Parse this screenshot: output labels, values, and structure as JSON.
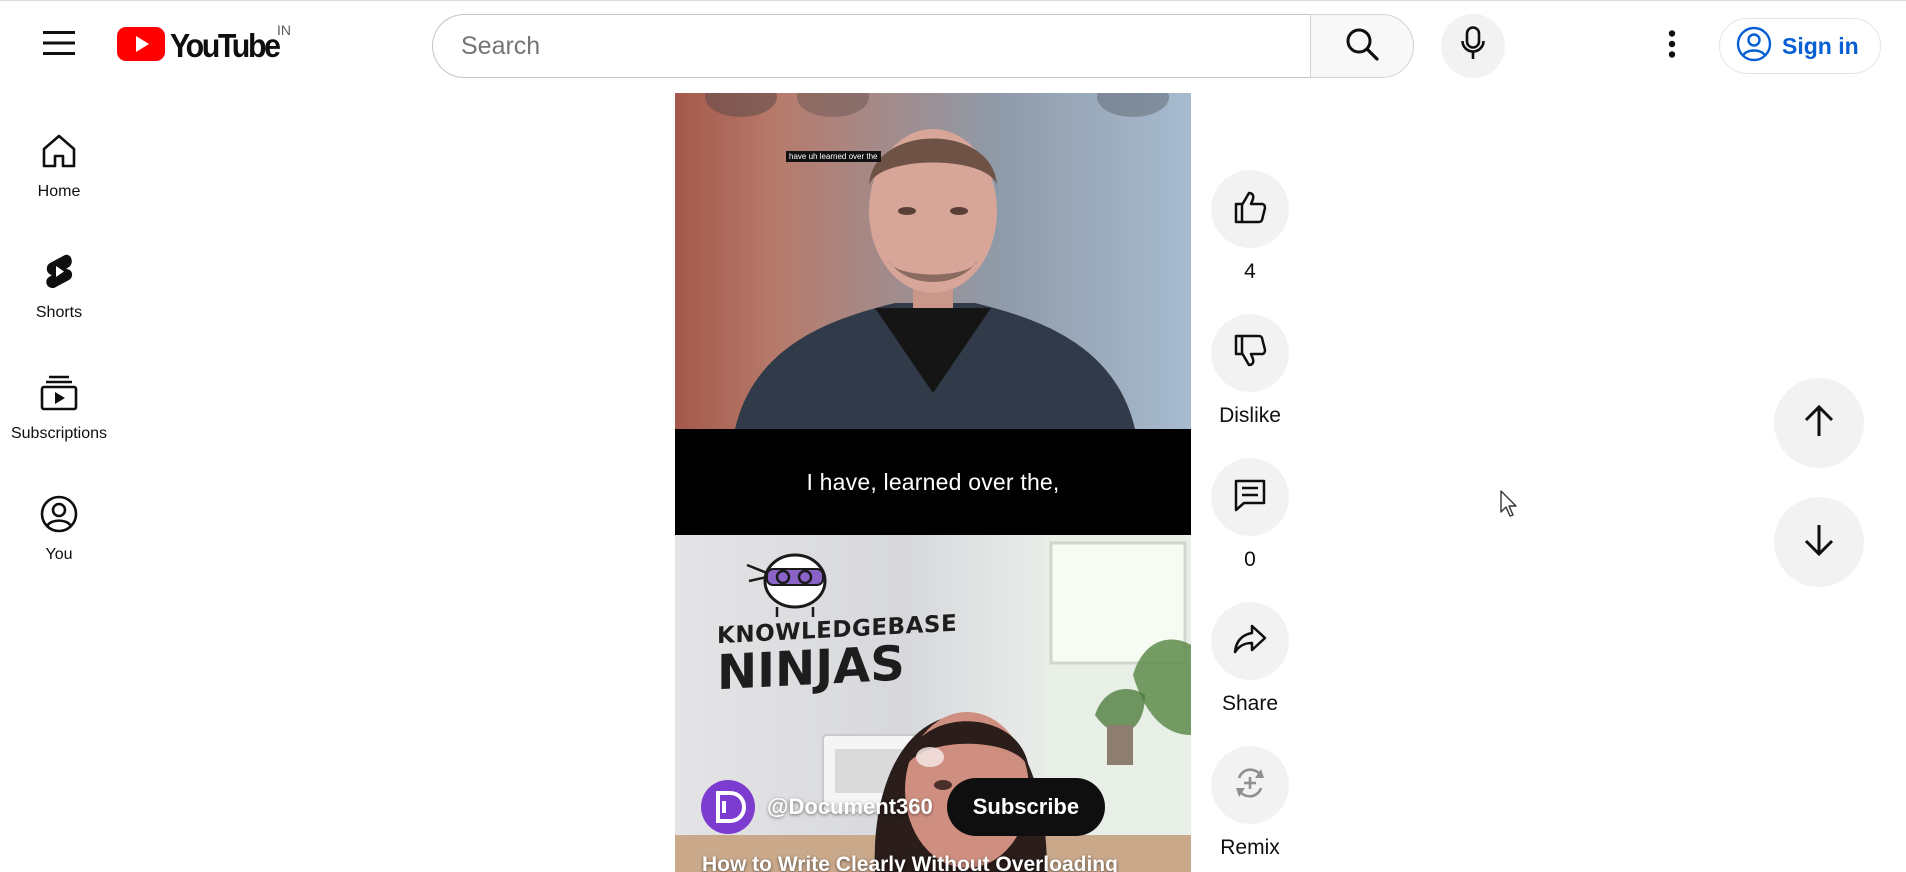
{
  "header": {
    "logo_text": "YouTube",
    "country_code": "IN",
    "search_placeholder": "Search",
    "sign_in_label": "Sign in",
    "icons": [
      "hamburger-menu-icon",
      "youtube-play-logo",
      "search-icon",
      "microphone-icon",
      "more-vert-icon",
      "account-circle-icon"
    ]
  },
  "sidebar": {
    "items": [
      {
        "label": "Home",
        "icon": "home-icon"
      },
      {
        "label": "Shorts",
        "icon": "shorts-icon"
      },
      {
        "label": "Subscriptions",
        "icon": "subscriptions-icon"
      },
      {
        "label": "You",
        "icon": "you-icon"
      }
    ]
  },
  "player": {
    "burned_caption": "have uh learned over the",
    "caption": "I have, learned over the,",
    "brand_line1": "KNOWLEDGEBASE",
    "brand_line2": "NINJAS",
    "channel_name": "@Document360",
    "subscribe_label": "Subscribe",
    "title": "How to Write Clearly Without Overloading"
  },
  "actions": {
    "like_count": "4",
    "dislike_label": "Dislike",
    "comment_count": "0",
    "share_label": "Share",
    "remix_label": "Remix"
  },
  "navigation": {
    "icons": [
      "arrow-up-icon",
      "arrow-down-icon"
    ]
  },
  "colors": {
    "brand_red": "#ff0000",
    "link_blue": "#065fd4",
    "channel_purple": "#7c3ccf",
    "button_gray": "#f2f2f2"
  }
}
